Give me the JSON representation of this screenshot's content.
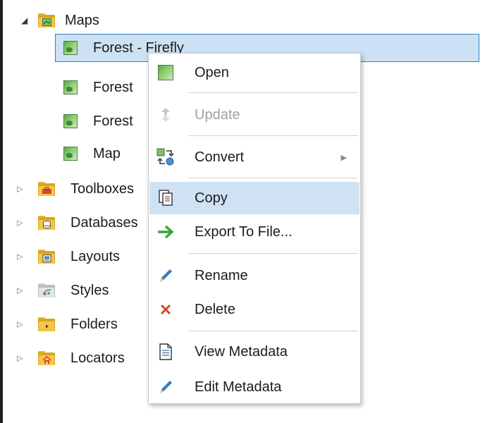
{
  "tree": {
    "maps": {
      "label": "Maps"
    },
    "map_items": [
      {
        "label": "Forest - Firefly"
      },
      {
        "label": "Forest"
      },
      {
        "label": "Forest"
      },
      {
        "label": "Map"
      }
    ],
    "folders": [
      {
        "label": "Toolboxes",
        "icon": "toolbox-icon"
      },
      {
        "label": "Databases",
        "icon": "database-icon"
      },
      {
        "label": "Layouts",
        "icon": "layout-icon"
      },
      {
        "label": "Styles",
        "icon": "styles-icon"
      },
      {
        "label": "Folders",
        "icon": "folder-icon"
      },
      {
        "label": "Locators",
        "icon": "locator-icon"
      }
    ]
  },
  "context_menu": {
    "items": [
      {
        "label": "Open",
        "icon": "map-icon",
        "enabled": true
      },
      {
        "label": "Update",
        "icon": "update-icon",
        "enabled": false
      },
      {
        "label": "Convert",
        "icon": "convert-icon",
        "enabled": true,
        "submenu": true
      },
      {
        "label": "Copy",
        "icon": "copy-icon",
        "enabled": true,
        "highlighted": true
      },
      {
        "label": "Export To File...",
        "icon": "export-arrow-icon",
        "enabled": true
      },
      {
        "label": "Rename",
        "icon": "pencil-icon",
        "enabled": true
      },
      {
        "label": "Delete",
        "icon": "delete-x-icon",
        "enabled": true
      },
      {
        "label": "View Metadata",
        "icon": "metadata-document-icon",
        "enabled": true
      },
      {
        "label": "Edit Metadata",
        "icon": "pencil-icon",
        "enabled": true
      }
    ]
  },
  "colors": {
    "selection_fill": "#cde1f4",
    "selection_border": "#2f7fc7",
    "menu_highlight": "#cfe2f3",
    "folder": "#f5c64a",
    "export_arrow": "#3aa335",
    "delete_x": "#d9451e",
    "pencil": "#2f7fc7"
  }
}
